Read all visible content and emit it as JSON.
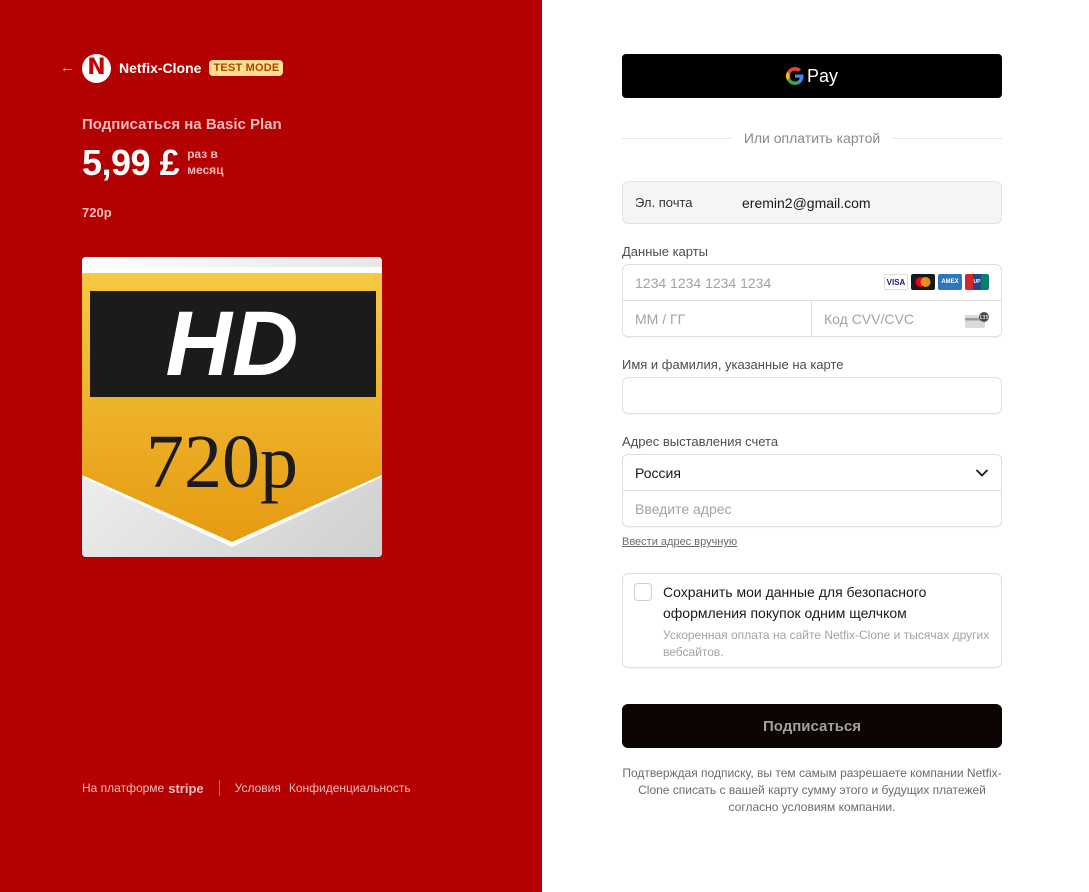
{
  "header": {
    "back_icon": "arrow-left-icon",
    "logo_letter": "N",
    "brand": "Netfix-Clone",
    "badge": "TEST MODE"
  },
  "plan": {
    "title": "Подписаться на Basic Plan",
    "price": "5,99 £",
    "period": "раз в месяц",
    "description": "720p",
    "image": {
      "top_text": "HD",
      "bottom_text": "720p"
    }
  },
  "footer": {
    "powered_prefix": "На платформе",
    "powered_brand": "stripe",
    "terms": "Условия",
    "privacy": "Конфиденциальность"
  },
  "payment": {
    "gpay_label": "Pay",
    "or_card": "Или оплатить картой",
    "email_label": "Эл. почта",
    "email_value": "eremin2@gmail.com",
    "card_label": "Данные карты",
    "card_number_placeholder": "1234 1234 1234 1234",
    "card_brands": [
      "VISA",
      "MC",
      "AMEX",
      "UnionPay"
    ],
    "expiry_placeholder": "ММ / ГГ",
    "cvc_placeholder": "Код CVV/CVC",
    "cvc_badge": "135",
    "name_label": "Имя и фамилия, указанные на карте",
    "name_value": "",
    "address_label": "Адрес выставления счета",
    "country": "Россия",
    "address_placeholder": "Введите адрес",
    "manual_address": "Ввести адрес вручную",
    "save_title": "Сохранить мои данные для безопасного оформления покупок одним щелчком",
    "save_sub": "Ускоренная оплата на сайте Netfix-Clone и тысячах других вебсайтов.",
    "submit": "Подписаться",
    "terms": "Подтверждая подписку, вы тем самым разрешаете компании Netfix-Clone списать с вашей карту сумму этого и будущих платежей согласно условиям компании."
  },
  "colors": {
    "left_bg": "#b30000",
    "badge_bg": "#ffde92",
    "submit_bg": "#0d0404"
  }
}
